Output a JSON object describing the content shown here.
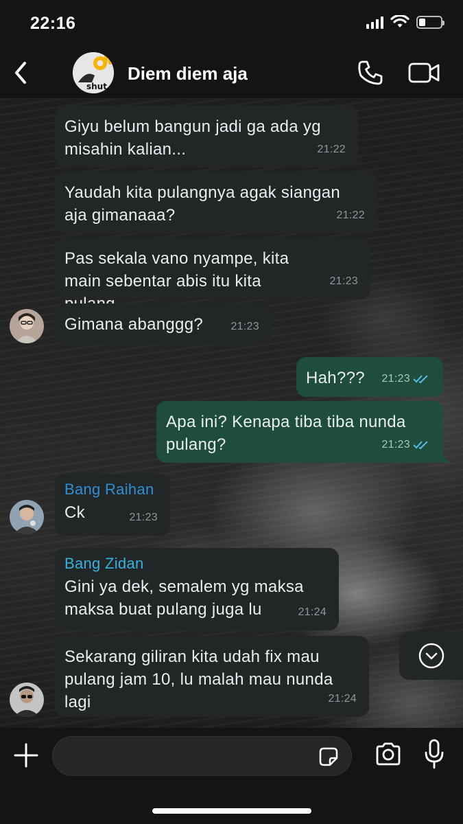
{
  "status_bar": {
    "time": "22:16",
    "battery_level": 0.3
  },
  "header": {
    "group_name": "Diem diem aja",
    "group_avatar_text": "shut",
    "icons": [
      "back-arrow-icon",
      "phone-icon",
      "video-camera-icon"
    ]
  },
  "messages": [
    {
      "type": "incoming",
      "text": "Giyu belum bangun jadi ga ada yg misahin kalian...",
      "time": "21:22"
    },
    {
      "type": "incoming",
      "text": "Yaudah kita pulangnya agak siangan aja gimanaaa?",
      "time": "21:22"
    },
    {
      "type": "incoming",
      "text": "Pas sekala vano nyampe, kita main sebentar abis itu kita pulang...",
      "time": "21:23"
    },
    {
      "type": "incoming",
      "text": "Gimana abanggg?",
      "time": "21:23"
    },
    {
      "type": "outgoing",
      "text": "Hah???",
      "time": "21:23",
      "status": "read"
    },
    {
      "type": "outgoing",
      "text": "Apa ini? Kenapa tiba tiba nunda pulang?",
      "time": "21:23",
      "status": "read"
    },
    {
      "type": "incoming",
      "sender": "Bang Raihan",
      "sender_color": "#2e8fd6",
      "text": "Ck",
      "time": "21:23"
    },
    {
      "type": "incoming",
      "sender": "Bang Zidan",
      "sender_color": "#33b3e0",
      "text": "Gini ya dek, semalem yg maksa maksa buat pulang juga lu",
      "time": "21:24"
    },
    {
      "type": "incoming",
      "text": "Sekarang giliran kita udah fix mau pulang jam 10, lu malah mau nunda lagi",
      "time": "21:24"
    }
  ],
  "input": {
    "placeholder": "",
    "value": ""
  },
  "colors": {
    "incoming_bubble": "#232627",
    "outgoing_bubble": "#1f4d3b",
    "read_ticks": "#53bdeb"
  }
}
